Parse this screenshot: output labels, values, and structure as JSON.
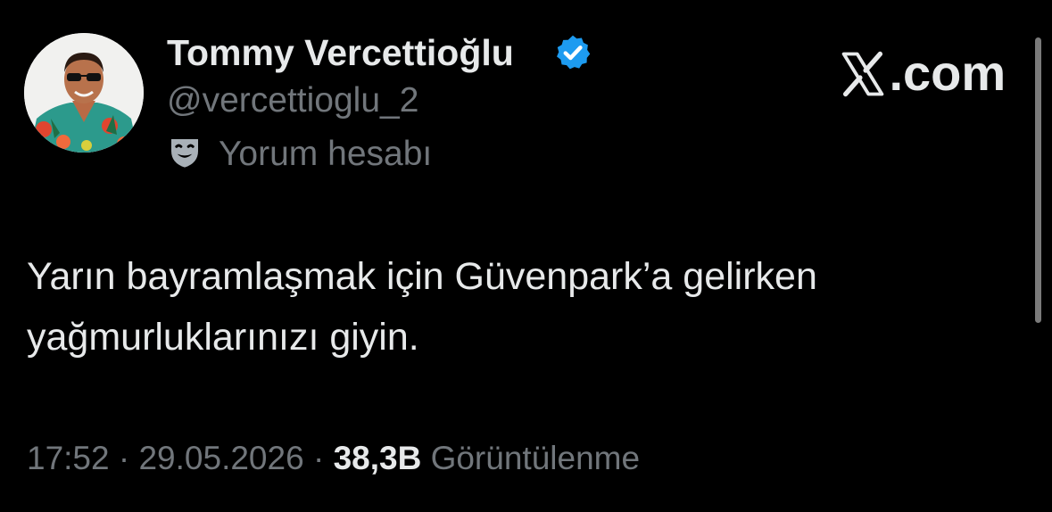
{
  "account": {
    "display_name": "Tommy Vercettioğlu",
    "handle": "@vercettioglu_2",
    "label": "Yorum hesabı",
    "label_icon": "theater-mask-icon",
    "verified": true,
    "verified_color": "#1d9bf0",
    "avatar_icon": "profile-photo-avatar"
  },
  "brand": {
    "logo_icon": "x-logo-icon",
    "domain": ".com"
  },
  "tweet": {
    "text_line_1": "Yarın bayramlaşmak için Güvenpark’a gelirken",
    "text_line_2": "yağmurluklarınızı giyin."
  },
  "meta": {
    "time": "17:52",
    "separator": "·",
    "date": "29.05.2026",
    "views_count": "38,3B",
    "views_label": "Görüntülenme"
  },
  "colors": {
    "background": "#000000",
    "primary_text": "#e7e9ea",
    "secondary_text": "#71767b"
  }
}
